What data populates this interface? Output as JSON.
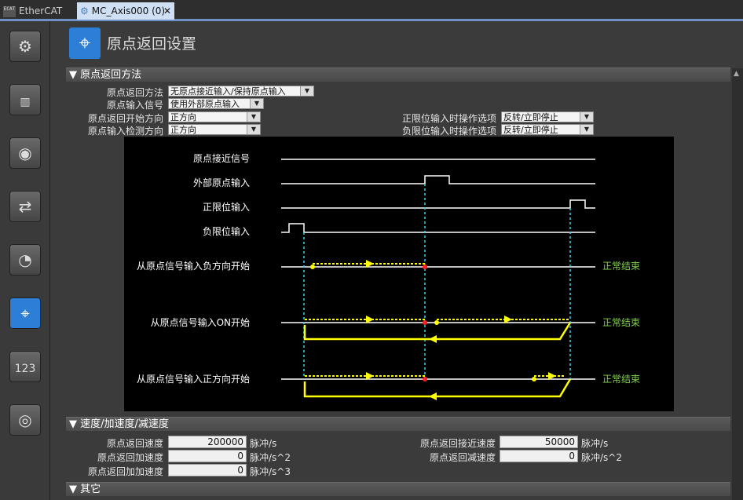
{
  "tabs": {
    "ethercat_icon": "ECAT",
    "ethercat": "EtherCAT",
    "axis": "MC_Axis000 (0)",
    "close": "✕"
  },
  "header": {
    "title": "原点返回设置"
  },
  "sections": {
    "homing_method": "▼ 原点返回方法",
    "speed": "▼ 速度/加速度/减速度",
    "other": "▼ 其它"
  },
  "homing": {
    "method_label": "原点返回方法",
    "method_value": "无原点接近输入/保持原点输入",
    "input_signal_label": "原点输入信号",
    "input_signal_value": "使用外部原点输入",
    "start_dir_label": "原点返回开始方向",
    "start_dir_value": "正方向",
    "detect_dir_label": "原点输入检测方向",
    "detect_dir_value": "正方向",
    "pos_limit_label": "正限位输入时操作选项",
    "pos_limit_value": "反转/立即停止",
    "neg_limit_label": "负限位输入时操作选项",
    "neg_limit_value": "反转/立即停止"
  },
  "diagram": {
    "sig_approach": "原点接近信号",
    "sig_external": "外部原点输入",
    "sig_pos_limit": "正限位输入",
    "sig_neg_limit": "负限位输入",
    "case1": "从原点信号输入负方向开始",
    "case2": "从原点信号输入ON开始",
    "case3": "从原点信号输入正方向开始",
    "end1": "正常结束",
    "end2": "正常结束",
    "end3": "正常结束"
  },
  "speed": {
    "home_speed_label": "原点返回速度",
    "home_speed_value": "200000",
    "home_speed_unit": "脉冲/s",
    "home_acc_label": "原点返回加速度",
    "home_acc_value": "0",
    "home_acc_unit": "脉冲/s^2",
    "home_jerk_label": "原点返回加加速度",
    "home_jerk_value": "0",
    "home_jerk_unit": "脉冲/s^3",
    "approach_speed_label": "原点返回接近速度",
    "approach_speed_value": "50000",
    "approach_speed_unit": "脉冲/s",
    "home_dec_label": "原点返回减速度",
    "home_dec_value": "0",
    "home_dec_unit": "脉冲/s^2"
  },
  "colors": {
    "accent": "#2d7ed6",
    "ok_text": "#7cd44a",
    "trace": "#ffff00",
    "cyan": "#33d6e8",
    "marker": "#ff2020"
  }
}
